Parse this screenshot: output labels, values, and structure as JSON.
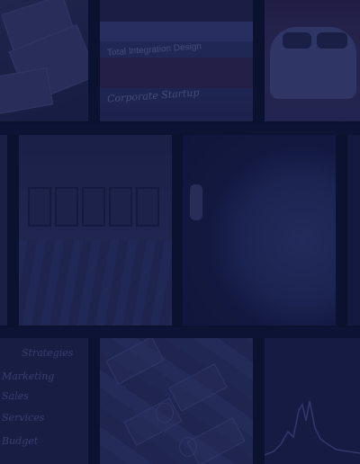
{
  "tiles": {
    "book": {
      "line1": "Total Integration Design",
      "line2": "Corporate Startup"
    },
    "notes": {
      "heading": "Strategies",
      "lines": [
        "Marketing",
        "Sales",
        "Services",
        "Budget"
      ]
    }
  },
  "colors": {
    "overlay": "#0c1238",
    "background": "#0b1230"
  }
}
